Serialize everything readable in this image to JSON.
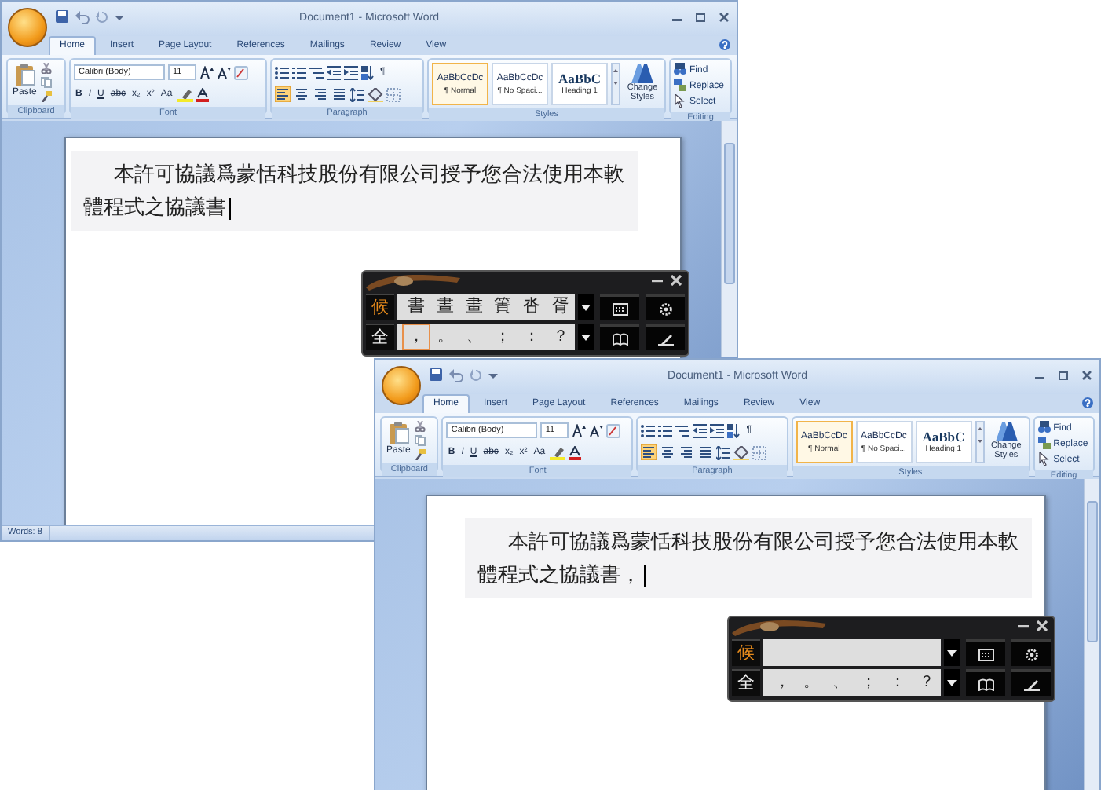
{
  "windows": [
    {
      "title": "Document1 - Microsoft Word",
      "tabs": [
        {
          "label": "Home",
          "selected": true
        },
        {
          "label": "Insert",
          "selected": false
        },
        {
          "label": "Page Layout",
          "selected": false
        },
        {
          "label": "References",
          "selected": false
        },
        {
          "label": "Mailings",
          "selected": false
        },
        {
          "label": "Review",
          "selected": false
        },
        {
          "label": "View",
          "selected": false
        }
      ],
      "ribbon": {
        "clipboard": {
          "label": "Clipboard",
          "paste": "Paste"
        },
        "font": {
          "label": "Font",
          "face": "Calibri (Body)",
          "size": "11",
          "format": [
            {
              "kind": "bold",
              "text": "B"
            },
            {
              "kind": "italic",
              "text": "I"
            },
            {
              "kind": "underline",
              "text": "U"
            },
            {
              "kind": "strikethrough",
              "text": "abc"
            },
            {
              "kind": "subscript",
              "text": "x₂"
            },
            {
              "kind": "superscript",
              "text": "x²"
            },
            {
              "kind": "change-case",
              "text": "Aa"
            }
          ]
        },
        "paragraph": {
          "label": "Paragraph",
          "show_marks": "¶",
          "alignment": [
            {
              "selected": true
            },
            {
              "selected": false
            },
            {
              "selected": false
            },
            {
              "selected": false
            }
          ]
        },
        "styles": {
          "label": "Styles",
          "items": [
            {
              "kind": "body",
              "sample": "AaBbCcDc",
              "name": "¶ Normal",
              "selected": true
            },
            {
              "kind": "body",
              "sample": "AaBbCcDc",
              "name": "¶ No Spaci...",
              "selected": false
            },
            {
              "kind": "heading",
              "sample": "AaBbC",
              "name": "Heading 1",
              "selected": false
            }
          ],
          "change": "Change Styles"
        },
        "editing": {
          "label": "Editing",
          "items": [
            "Find",
            "Replace",
            "Select"
          ]
        }
      },
      "document": {
        "lines": [
          "本許可協議爲蒙恬科技股份有限公司授予您合法使用本軟",
          "體程式之協議書"
        ]
      },
      "status_bar": {
        "words": "Words: 8"
      },
      "ime": {
        "mode": "候",
        "width_mode": "全",
        "candidates": [
          {
            "text": "書",
            "selected": false
          },
          {
            "text": "晝",
            "selected": false
          },
          {
            "text": "畫",
            "selected": false
          },
          {
            "text": "簀",
            "selected": false
          },
          {
            "text": "沓",
            "selected": false
          },
          {
            "text": "胥",
            "selected": false
          }
        ],
        "symbols": [
          {
            "text": "，",
            "selected": true
          },
          {
            "text": "。",
            "selected": false
          },
          {
            "text": "、",
            "selected": false
          },
          {
            "text": "；",
            "selected": false
          },
          {
            "text": "：",
            "selected": false
          },
          {
            "text": "？",
            "selected": false
          }
        ]
      }
    },
    {
      "title": "Document1 - Microsoft Word",
      "tabs": [
        {
          "label": "Home",
          "selected": true
        },
        {
          "label": "Insert",
          "selected": false
        },
        {
          "label": "Page Layout",
          "selected": false
        },
        {
          "label": "References",
          "selected": false
        },
        {
          "label": "Mailings",
          "selected": false
        },
        {
          "label": "Review",
          "selected": false
        },
        {
          "label": "View",
          "selected": false
        }
      ],
      "ribbon": {
        "clipboard": {
          "label": "Clipboard",
          "paste": "Paste"
        },
        "font": {
          "label": "Font",
          "face": "Calibri (Body)",
          "size": "11",
          "format": [
            {
              "kind": "bold",
              "text": "B"
            },
            {
              "kind": "italic",
              "text": "I"
            },
            {
              "kind": "underline",
              "text": "U"
            },
            {
              "kind": "strikethrough",
              "text": "abc"
            },
            {
              "kind": "subscript",
              "text": "x₂"
            },
            {
              "kind": "superscript",
              "text": "x²"
            },
            {
              "kind": "change-case",
              "text": "Aa"
            }
          ]
        },
        "paragraph": {
          "label": "Paragraph",
          "show_marks": "¶",
          "alignment": [
            {
              "selected": true
            },
            {
              "selected": false
            },
            {
              "selected": false
            },
            {
              "selected": false
            }
          ]
        },
        "styles": {
          "label": "Styles",
          "items": [
            {
              "kind": "body",
              "sample": "AaBbCcDc",
              "name": "¶ Normal",
              "selected": true
            },
            {
              "kind": "body",
              "sample": "AaBbCcDc",
              "name": "¶ No Spaci...",
              "selected": false
            },
            {
              "kind": "heading",
              "sample": "AaBbC",
              "name": "Heading 1",
              "selected": false
            }
          ],
          "change": "Change Styles"
        },
        "editing": {
          "label": "Editing",
          "items": [
            "Find",
            "Replace",
            "Select"
          ]
        }
      },
      "document": {
        "lines": [
          "本許可協議爲蒙恬科技股份有限公司授予您合法使用本軟",
          "體程式之協議書，"
        ]
      },
      "ime": {
        "mode": "候",
        "width_mode": "全",
        "symbols": [
          {
            "text": "，",
            "selected": false
          },
          {
            "text": "。",
            "selected": false
          },
          {
            "text": "、",
            "selected": false
          },
          {
            "text": "；",
            "selected": false
          },
          {
            "text": "：",
            "selected": false
          },
          {
            "text": "？",
            "selected": false
          }
        ]
      }
    }
  ]
}
